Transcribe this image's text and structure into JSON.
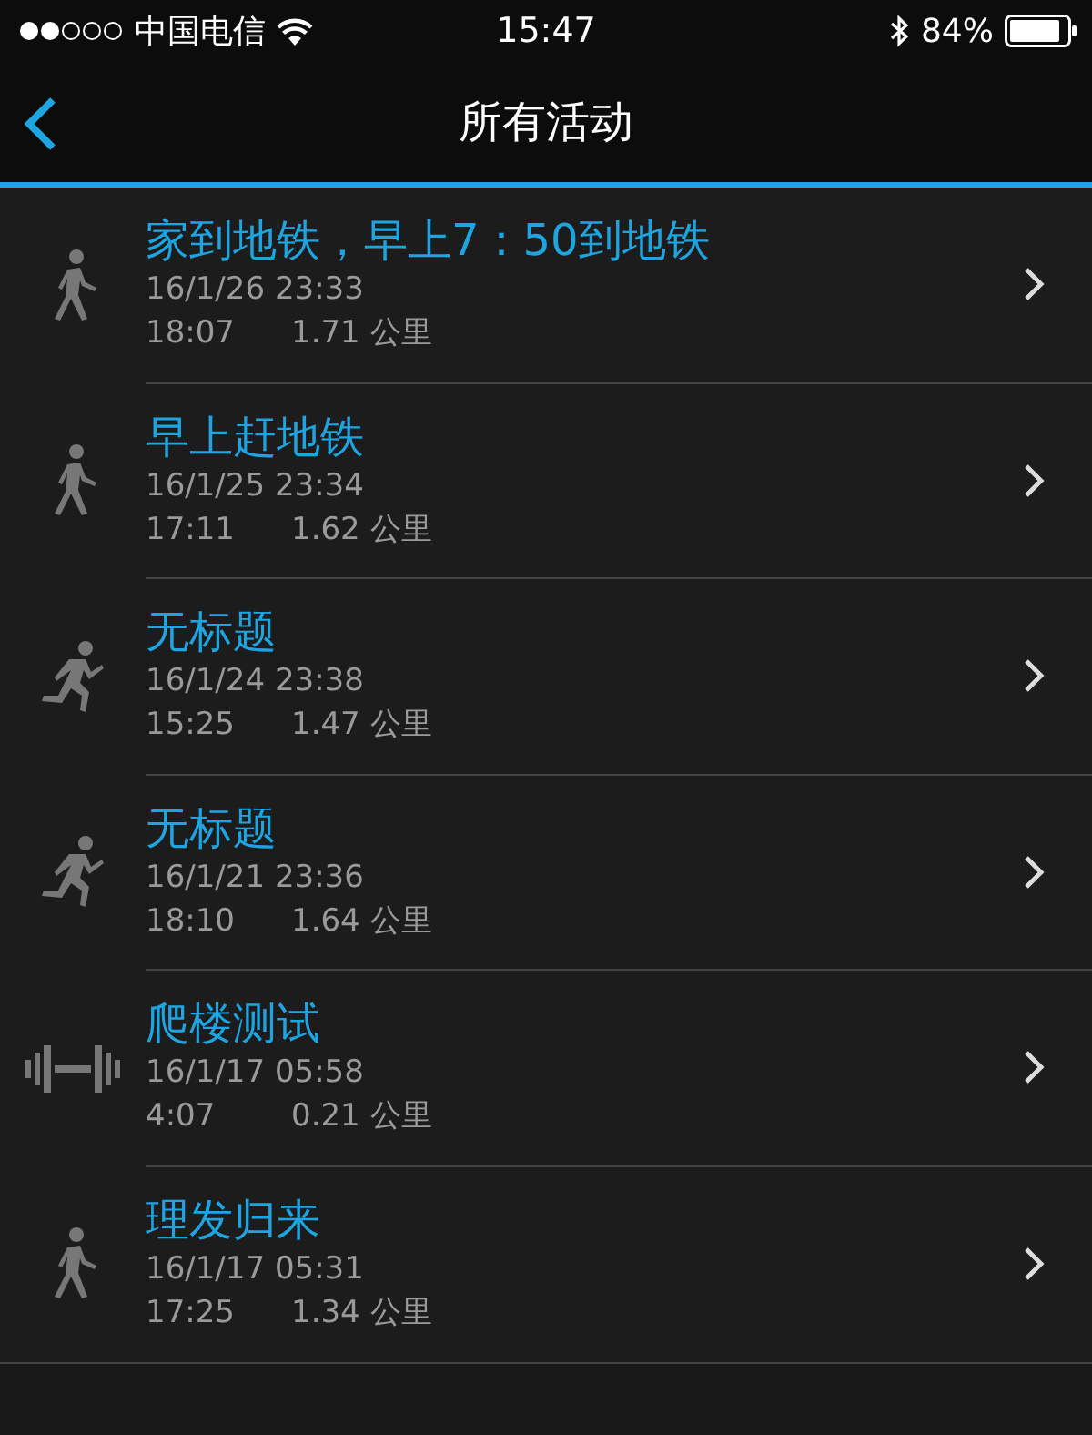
{
  "status_bar": {
    "carrier": "中国电信",
    "time": "15:47",
    "battery": "84%"
  },
  "nav": {
    "title": "所有活动"
  },
  "activities": [
    {
      "kind": "walk",
      "title": "家到地铁，早上7：50到地铁",
      "date": "16/1/26 23:33",
      "duration": "18:07",
      "distance": "1.71 公里"
    },
    {
      "kind": "walk",
      "title": "早上赶地铁",
      "date": "16/1/25 23:34",
      "duration": "17:11",
      "distance": "1.62 公里"
    },
    {
      "kind": "run",
      "title": "无标题",
      "date": "16/1/24 23:38",
      "duration": "15:25",
      "distance": "1.47 公里"
    },
    {
      "kind": "run",
      "title": "无标题",
      "date": "16/1/21 23:36",
      "duration": "18:10",
      "distance": "1.64 公里"
    },
    {
      "kind": "strength",
      "title": "爬楼测试",
      "date": "16/1/17 05:58",
      "duration": "4:07",
      "distance": "0.21 公里"
    },
    {
      "kind": "walk",
      "title": "理发归来",
      "date": "16/1/17 05:31",
      "duration": "17:25",
      "distance": "1.34 公里"
    }
  ]
}
